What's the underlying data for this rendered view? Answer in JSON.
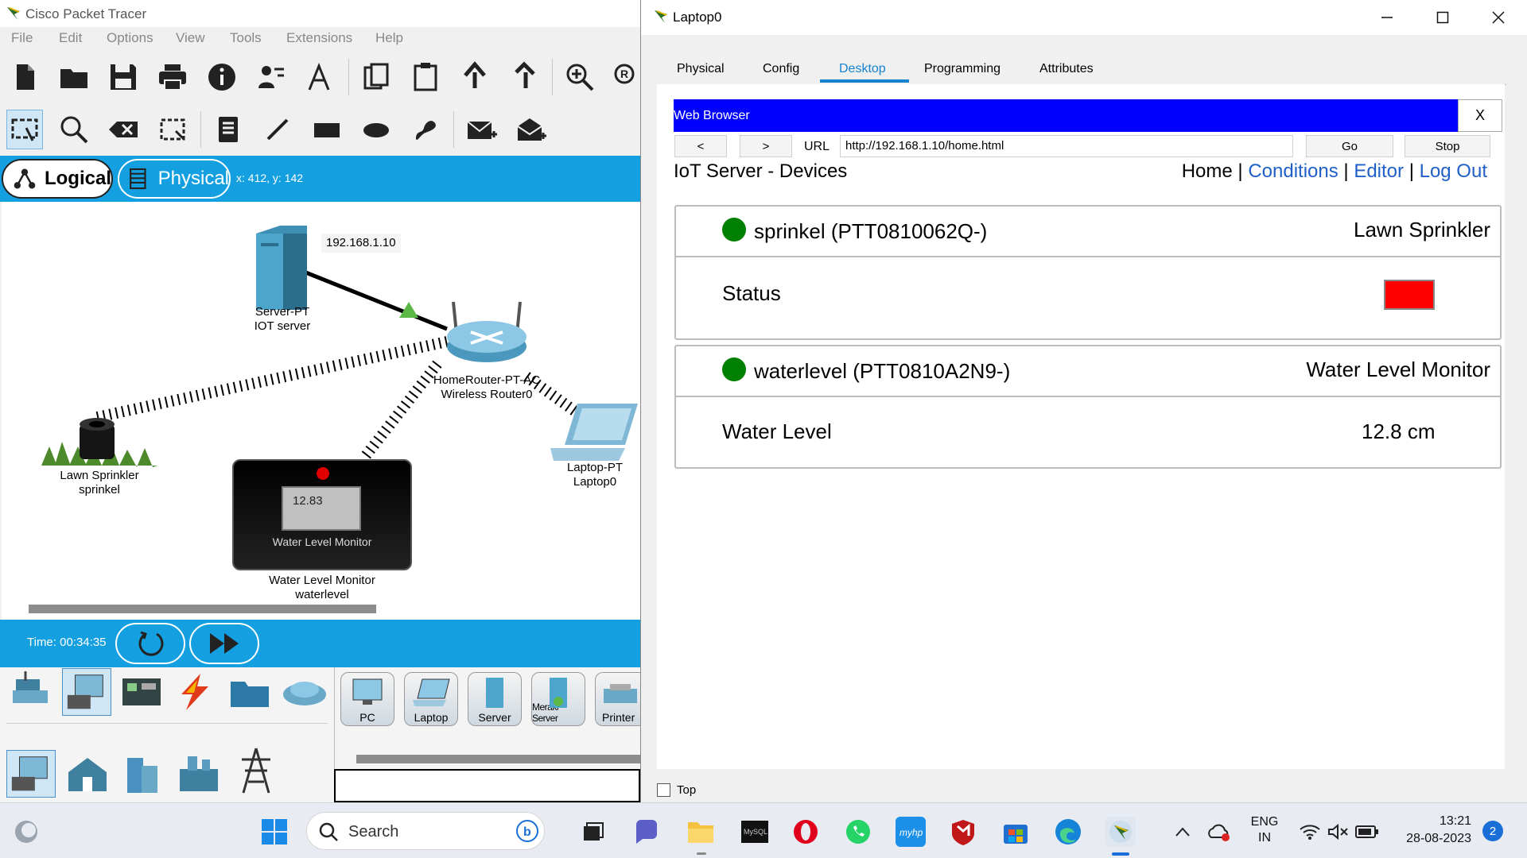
{
  "pt": {
    "title": "Cisco Packet Tracer",
    "menu": [
      "File",
      "Edit",
      "Options",
      "View",
      "Tools",
      "Extensions",
      "Help"
    ],
    "modes": {
      "logical": "Logical",
      "physical": "Physical"
    },
    "coords": "x: 412, y: 142",
    "devices": {
      "server_name": "Server-PT",
      "server_label": "IOT server",
      "server_ip": "192.168.1.10",
      "router_name": "HomeRouter-PT-AC",
      "router_label": "Wireless Router0",
      "sprinkler_name": "Lawn Sprinkler",
      "sprinkler_label": "sprinkel",
      "monitor_name": "Water Level Monitor",
      "monitor_label": "waterlevel",
      "monitor_value": "12.83",
      "monitor_screen_title": "Water Level Monitor",
      "laptop_name": "Laptop-PT",
      "laptop_label": "Laptop0"
    },
    "time": "Time: 00:34:35",
    "device_list": [
      "PC",
      "Laptop",
      "Server",
      "Meraki Server",
      "Printer"
    ]
  },
  "laptop": {
    "title": "Laptop0",
    "tabs": [
      "Physical",
      "Config",
      "Desktop",
      "Programming",
      "Attributes"
    ],
    "active_tab": "Desktop",
    "browser": {
      "title": "Web Browser",
      "close": "X",
      "back": "<",
      "forward": ">",
      "url_label": "URL",
      "url": "http://192.168.1.10/home.html",
      "go": "Go",
      "stop": "Stop",
      "heading": "IoT Server - Devices",
      "nav": {
        "home": "Home",
        "sep": "|",
        "conditions": "Conditions",
        "editor": "Editor",
        "logout": "Log Out"
      },
      "cards": [
        {
          "name": "sprinkel (PTT0810062Q-)",
          "type": "Lawn Sprinkler",
          "field": "Status",
          "status_color": "#ff0000"
        },
        {
          "name": "waterlevel (PTT0810A2N9-)",
          "type": "Water Level Monitor",
          "field": "Water Level",
          "value": "12.8 cm"
        }
      ]
    },
    "top_checkbox": "Top"
  },
  "taskbar": {
    "search": "Search",
    "lang1": "ENG",
    "lang2": "IN",
    "time": "13:21",
    "date": "28-08-2023",
    "notifications": "2"
  }
}
